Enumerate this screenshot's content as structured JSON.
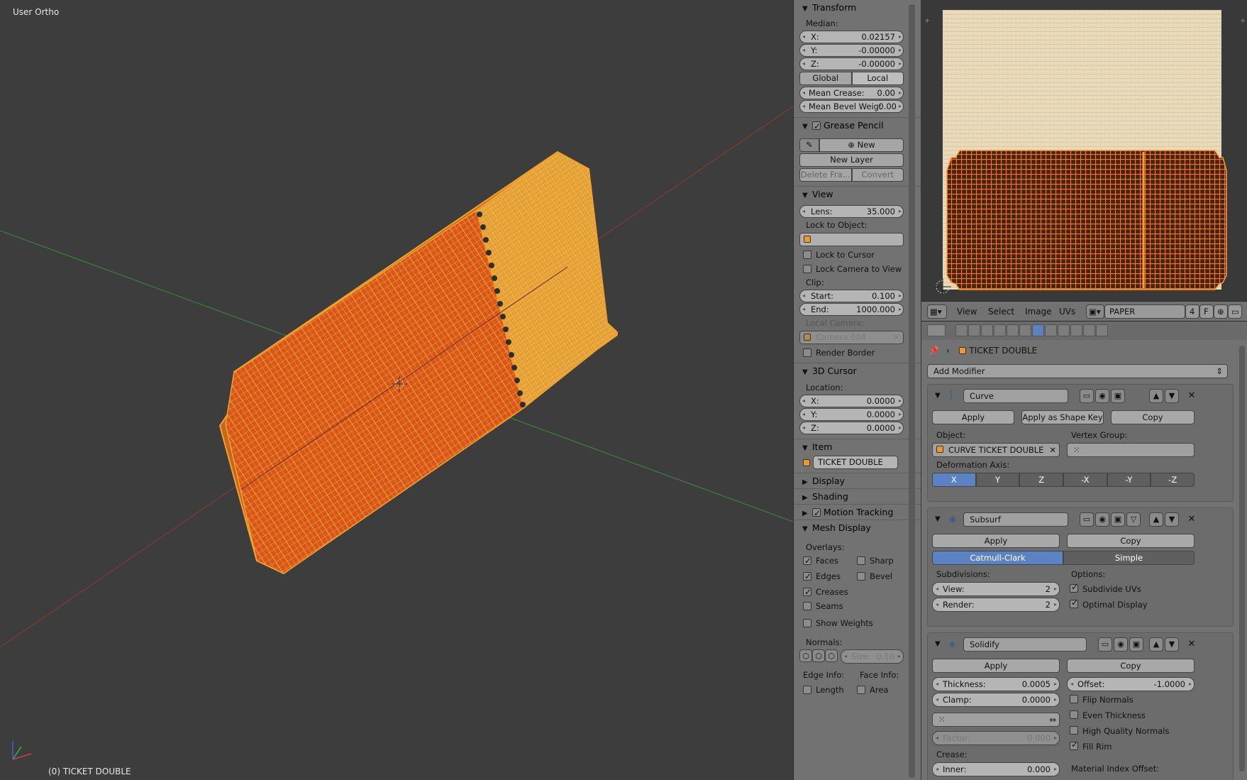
{
  "viewport": {
    "view_label": "User Ortho",
    "object_label": "(0) TICKET DOUBLE"
  },
  "npanel": {
    "transform": {
      "title": "Transform",
      "median_label": "Median:",
      "x_key": "X:",
      "x_val": "0.02157",
      "y_key": "Y:",
      "y_val": "-0.00000",
      "z_key": "Z:",
      "z_val": "-0.00000",
      "global_label": "Global",
      "local_label": "Local",
      "mean_crease_key": "Mean Crease:",
      "mean_crease_val": "0.00",
      "mean_bevel_key": "Mean Bevel Weig:",
      "mean_bevel_val": "0.00"
    },
    "grease_pencil": {
      "title": "Grease Pencil",
      "new_label": "New",
      "new_layer_label": "New Layer",
      "delete_frame_label": "Delete Fra...",
      "convert_label": "Convert"
    },
    "view": {
      "title": "View",
      "lens_key": "Lens:",
      "lens_val": "35.000",
      "lock_to_object_label": "Lock to Object:",
      "lock_to_cursor_label": "Lock to Cursor",
      "lock_camera_label": "Lock Camera to View",
      "clip_label": "Clip:",
      "start_key": "Start:",
      "start_val": "0.100",
      "end_key": "End:",
      "end_val": "1000.000",
      "local_camera_label": "Local Camera:",
      "local_camera_value": "Camera.004",
      "render_border_label": "Render Border"
    },
    "cursor3d": {
      "title": "3D Cursor",
      "location_label": "Location:",
      "x_key": "X:",
      "x_val": "0.0000",
      "y_key": "Y:",
      "y_val": "0.0000",
      "z_key": "Z:",
      "z_val": "0.0000"
    },
    "item": {
      "title": "Item",
      "name": "TICKET DOUBLE"
    },
    "display_title": "Display",
    "shading_title": "Shading",
    "motion_tracking_title": "Motion Tracking",
    "mesh_display": {
      "title": "Mesh Display",
      "overlays_label": "Overlays:",
      "faces": "Faces",
      "sharp": "Sharp",
      "edges": "Edges",
      "bevel": "Bevel",
      "creases": "Creases",
      "seams": "Seams",
      "show_weights": "Show Weights",
      "normals_label": "Normals:",
      "size_key": "Size:",
      "size_val": "0.10",
      "edge_info_label": "Edge Info:",
      "face_info_label": "Face Info:",
      "length": "Length",
      "area": "Area"
    }
  },
  "image_editor": {
    "menu": {
      "view": "View",
      "select": "Select",
      "image": "Image",
      "uvs": "UVs"
    },
    "image_name": "PAPER DIFFUSE.jpg",
    "users": "4",
    "fake_user": "F"
  },
  "properties": {
    "breadcrumb_object": "TICKET DOUBLE",
    "add_modifier": "Add Modifier",
    "curve": {
      "name": "Curve",
      "apply": "Apply",
      "apply_shape": "Apply as Shape Key",
      "copy": "Copy",
      "object_label": "Object:",
      "object_value": "CURVE TICKET DOUBLE",
      "vertex_group_label": "Vertex Group:",
      "deformation_axis_label": "Deformation Axis:",
      "axes": [
        "X",
        "Y",
        "Z",
        "-X",
        "-Y",
        "-Z"
      ]
    },
    "subsurf": {
      "name": "Subsurf",
      "apply": "Apply",
      "copy": "Copy",
      "catmull": "Catmull-Clark",
      "simple": "Simple",
      "subdivisions_label": "Subdivisions:",
      "options_label": "Options:",
      "view_key": "View:",
      "view_val": "2",
      "render_key": "Render:",
      "render_val": "2",
      "subdivide_uvs": "Subdivide UVs",
      "optimal_display": "Optimal Display"
    },
    "solidify": {
      "name": "Solidify",
      "apply": "Apply",
      "copy": "Copy",
      "thickness_key": "Thickness:",
      "thickness_val": "0.0005",
      "offset_key": "Offset:",
      "offset_val": "-1.0000",
      "clamp_key": "Clamp:",
      "clamp_val": "0.0000",
      "flip_normals": "Flip Normals",
      "even_thickness": "Even Thickness",
      "high_quality_normals": "High Quality Normals",
      "factor_key": "Factor:",
      "factor_val": "0.000",
      "fill_rim": "Fill Rim",
      "crease_label": "Crease:",
      "inner_key": "Inner:",
      "inner_val": "0.000",
      "material_index_offset": "Material Index Offset:"
    }
  },
  "colors": {
    "accent": "#5b83c3",
    "wire_orange": "#f0a22e",
    "face_orange": "#d9561a"
  }
}
